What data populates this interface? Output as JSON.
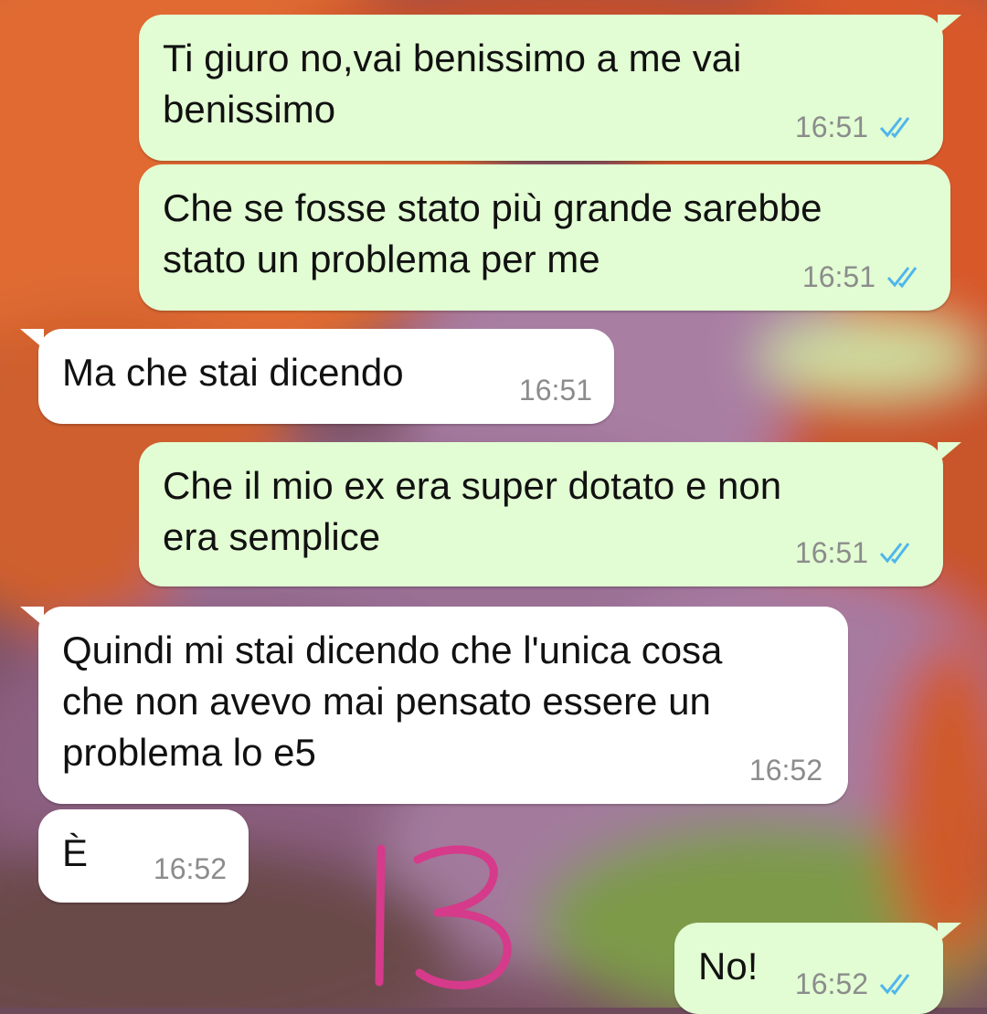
{
  "colors": {
    "outgoing_bubble": "#e2fdd3",
    "incoming_bubble": "#ffffff",
    "read_ticks": "#4fb6ec",
    "timestamp": "#8c8c8c",
    "annotation": "#d63a8a"
  },
  "icons": {
    "read_receipt": "double-check-icon"
  },
  "messages": [
    {
      "direction": "outgoing",
      "text": "Ti giuro no,vai benissimo a me vai\nbenissimo",
      "time": "16:51",
      "status": "read"
    },
    {
      "direction": "outgoing",
      "text": "Che se fosse stato più grande sarebbe\nstato un problema per me",
      "time": "16:51",
      "status": "read"
    },
    {
      "direction": "incoming",
      "text": "Ma che stai dicendo",
      "time": "16:51"
    },
    {
      "direction": "outgoing",
      "text": "Che il mio ex era super dotato e non\nera semplice",
      "time": "16:51",
      "status": "read"
    },
    {
      "direction": "incoming",
      "text": "Quindi mi stai dicendo che l'unica cosa\nche non avevo mai pensato essere un\nproblema lo e5",
      "time": "16:52"
    },
    {
      "direction": "incoming",
      "text": "È",
      "time": "16:52"
    },
    {
      "direction": "outgoing",
      "text": "No!",
      "time": "16:52",
      "status": "read"
    }
  ],
  "annotation": {
    "text": "13"
  }
}
